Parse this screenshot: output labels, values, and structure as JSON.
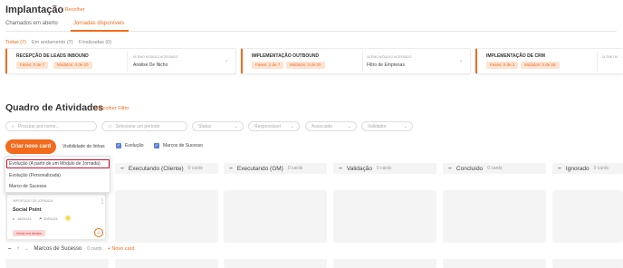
{
  "header": {
    "title": "Implantação",
    "collapse_label": "Recolher",
    "collapse_icon": "chevron-up-icon"
  },
  "tabs": [
    {
      "label": "Chamados em aberto",
      "active": false
    },
    {
      "label": "Jornadas disponíveis",
      "active": true
    }
  ],
  "subtabs": [
    {
      "label": "Todas (7)",
      "active": true
    },
    {
      "label": "Em andamento (7)",
      "active": false
    },
    {
      "label": "Finalizadas (0)",
      "active": false
    }
  ],
  "journeys": [
    {
      "name": "RECEPÇÃO DE LEADS INBOUND",
      "phases": "Fases: 0 de 7",
      "modules": "Módulos: 4 de 20",
      "module_label": "ÚLTIMO MÓDULO ACESSADO",
      "module_value": "Análise De Nicho"
    },
    {
      "name": "IMPLEMENTAÇÃO OUTBOUND",
      "phases": "Fases: 1 de 7",
      "modules": "Módulos: 3 de 20",
      "module_label": "ÚLTIMO MÓDULO ACESSADO",
      "module_value": "Filtro de Empresas"
    },
    {
      "name": "IMPLEMENTAÇÃO DE CRM",
      "phases": "Fases: 0 de 3",
      "modules": "Módulos: 0 de 28",
      "module_label": "ÚLTIMO M",
      "module_value": ""
    }
  ],
  "activities": {
    "title": "Quadro de Atividades",
    "collapse_filter_label": "Recolher Filtro",
    "filters": {
      "search_placeholder": "Procurar por nome...",
      "period_placeholder": "Selecione um período",
      "status": "Status",
      "responsible": "Responsável",
      "associated": "Associado",
      "validator": "Validador"
    },
    "create_button": "Criar novo card",
    "visibility_label": "Visibilidade de linhas",
    "visibility_options": [
      {
        "label": "Evolução",
        "checked": true
      },
      {
        "label": "Marcos de Sucesso",
        "checked": true
      }
    ]
  },
  "dropdown": {
    "items": [
      "Evolução (A partir de um Módulo de Jornada)",
      "Evolução (Personalizada)",
      "Marco de Sucesso"
    ],
    "highlighted_index": 0
  },
  "columns": [
    {
      "name": "Executando (Cliente)",
      "count": "0 cards"
    },
    {
      "name": "Executando (GM)",
      "count": "0 cards"
    },
    {
      "name": "Validação",
      "count": "0 cards"
    },
    {
      "name": "Concluído",
      "count": "0 cards"
    },
    {
      "name": "Ignorado",
      "count": "0 cards"
    }
  ],
  "card": {
    "label": "IMPORTADO DE JORNADA",
    "name": "Social Point",
    "start_date": "16/01/24",
    "end_date": "30/01/24",
    "badge": "Inicia em atraso"
  },
  "bottom": {
    "section_name": "Marcos de Sucesso",
    "count": "0 cards",
    "new_card_label": "+ Novo card"
  }
}
